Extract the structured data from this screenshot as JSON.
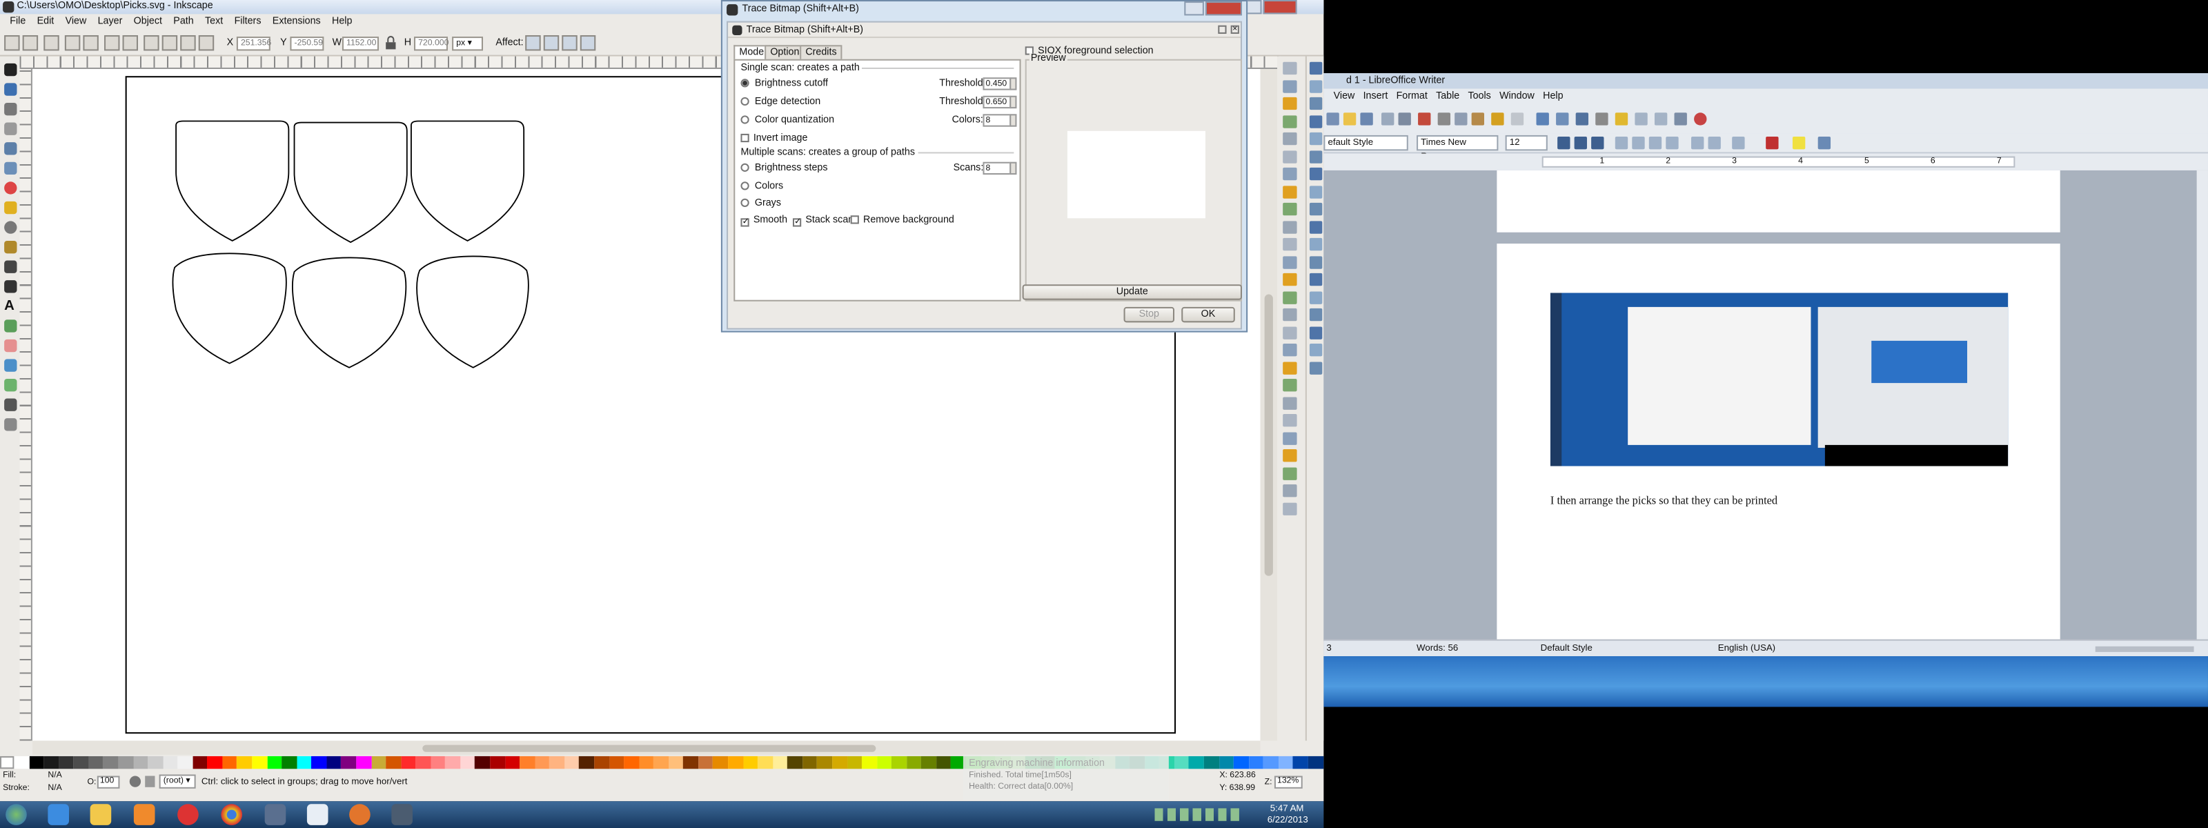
{
  "inkscape": {
    "title": "C:\\Users\\OMO\\Desktop\\Picks.svg - Inkscape",
    "menu": [
      "File",
      "Edit",
      "View",
      "Layer",
      "Object",
      "Path",
      "Text",
      "Filters",
      "Extensions",
      "Help"
    ],
    "toolbar": {
      "x_label": "X",
      "x_value": "251.356",
      "y_label": "Y",
      "y_value": "-250.59",
      "w_label": "W",
      "w_value": "1152.00",
      "h_label": "H",
      "h_value": "720.000",
      "unit": "px",
      "affect_label": "Affect:"
    },
    "status": {
      "fill_label": "Fill:",
      "fill_value": "N/A",
      "stroke_label": "Stroke:",
      "stroke_value": "N/A",
      "opacity_label": "O:",
      "opacity_value": "100",
      "layer": "(root)",
      "hint": "Ctrl: click to select in groups; drag to move hor/vert",
      "x_coord": "X: 623.86",
      "y_coord": "Y: 638.99",
      "zoom_label": "Z:",
      "zoom_value": "132%"
    },
    "palette": [
      "#ffffff",
      "#000000",
      "#1a1a1a",
      "#333333",
      "#4d4d4d",
      "#666666",
      "#808080",
      "#999999",
      "#b3b3b3",
      "#cccccc",
      "#e6e6e6",
      "#f2f2f2",
      "#800000",
      "#ff0000",
      "#ff6600",
      "#ffcc00",
      "#ffff00",
      "#00ff00",
      "#008000",
      "#00ffff",
      "#0000ff",
      "#000080",
      "#800080",
      "#ff00ff",
      "#c8ab37",
      "#d45500",
      "#ff2a2a",
      "#ff5555",
      "#ff8080",
      "#ffaaaa",
      "#ffd5d5",
      "#550000",
      "#aa0000",
      "#d40000",
      "#ff7f2a",
      "#ff9955",
      "#ffb380",
      "#ffccaa",
      "#552200",
      "#aa4400",
      "#d45500",
      "#ff6600",
      "#ff8d29",
      "#ffa54f",
      "#ffbf7a",
      "#803300",
      "#c87137",
      "#e68a00",
      "#ffaa00",
      "#ffcc00",
      "#ffdd55",
      "#ffee99",
      "#554400",
      "#806600",
      "#aa8800",
      "#d4aa00",
      "#c8b700",
      "#eeff00",
      "#ccff00",
      "#aad400",
      "#88aa00",
      "#668000",
      "#445500",
      "#00aa00",
      "#00d400",
      "#2ad42a",
      "#55d455",
      "#80e580",
      "#00aa44",
      "#008033",
      "#00ff66",
      "#37c871",
      "#5fd38d",
      "#87deaa",
      "#00aa88",
      "#008066",
      "#00ccaa",
      "#2ad4aa",
      "#55ddc0",
      "#00aaaa",
      "#008080",
      "#0088aa",
      "#0066ff",
      "#2a7fff",
      "#5599ff",
      "#80b3ff",
      "#0044aa",
      "#003380"
    ]
  },
  "trace_dialog": {
    "outer_title": "Trace Bitmap (Shift+Alt+B)",
    "inner_title": "Trace Bitmap (Shift+Alt+B)",
    "tabs": [
      "Mode",
      "Options",
      "Credits"
    ],
    "single_scan_title": "Single scan: creates a path",
    "brightness_cutoff": "Brightness cutoff",
    "threshold_label": "Threshold:",
    "threshold_1": "0.450",
    "edge_detection": "Edge detection",
    "threshold_2": "0.650",
    "color_quantization": "Color quantization",
    "colors_label": "Colors:",
    "colors_value": "8",
    "invert_image": "Invert image",
    "multiple_scans_title": "Multiple scans: creates a group of paths",
    "brightness_steps": "Brightness steps",
    "scans_label": "Scans:",
    "scans_value": "8",
    "colors_option": "Colors",
    "grays_option": "Grays",
    "smooth": "Smooth",
    "stack_scans": "Stack scans",
    "remove_background": "Remove background",
    "siox": "SIOX foreground selection",
    "preview_label": "Preview",
    "update": "Update",
    "stop": "Stop",
    "ok": "OK"
  },
  "writer": {
    "title": "d 1 - LibreOffice Writer",
    "menu": [
      "View",
      "Insert",
      "Format",
      "Table",
      "Tools",
      "Window",
      "Help"
    ],
    "style_value": "efault Style",
    "font_value": "Times New Roman",
    "size_value": "12",
    "ruler_marks": [
      "1",
      "2",
      "3",
      "4",
      "5",
      "6",
      "7"
    ],
    "caption": "I then arrange the picks so that they can be printed",
    "status": {
      "page": "3",
      "words": "Words: 56",
      "style": "Default Style",
      "language": "English (USA)"
    }
  },
  "notification": {
    "title": "Engraving machine information",
    "line1": "Finished. Total time[1m50s]",
    "line2": "Health: Correct data[0.00%]"
  },
  "taskbar": {
    "time": "5:47 AM",
    "date": "6/22/2013"
  }
}
